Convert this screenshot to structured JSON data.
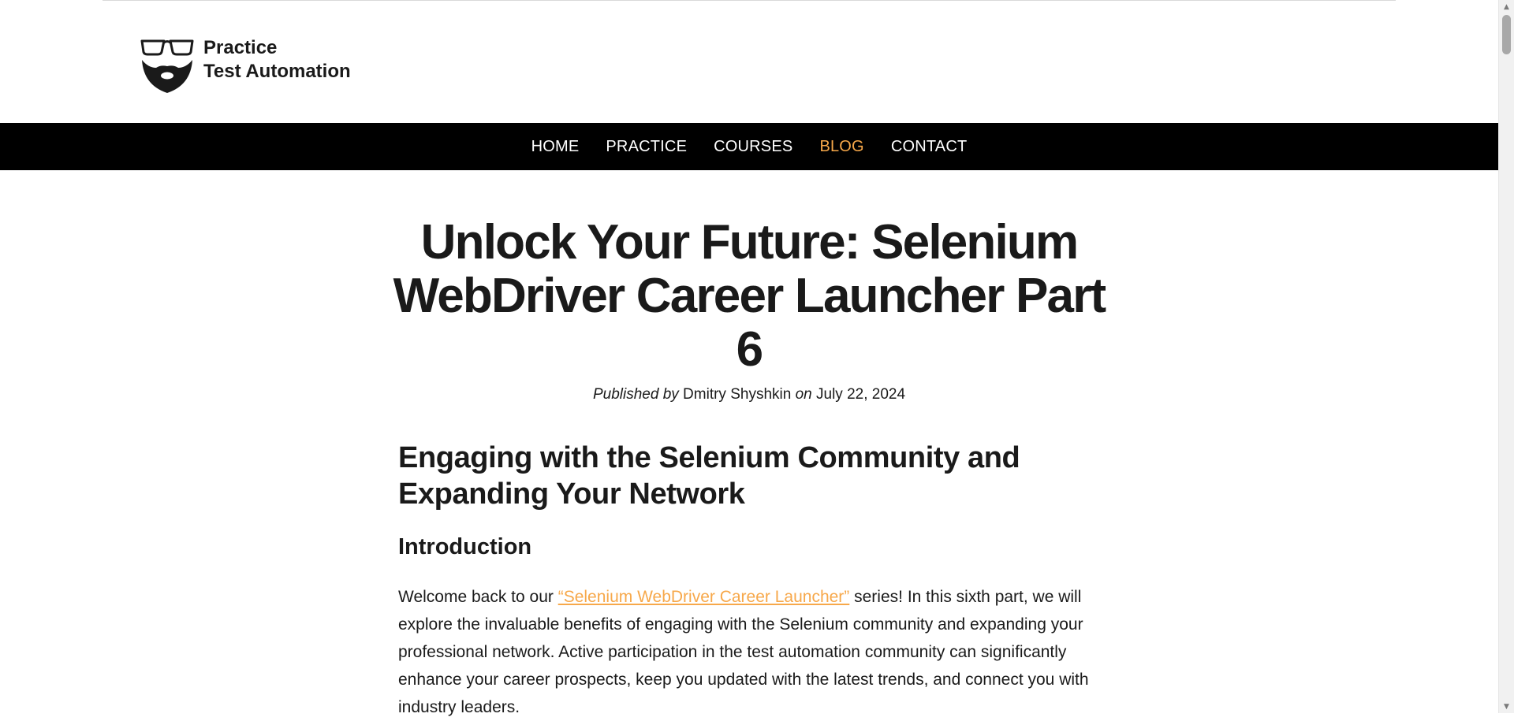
{
  "brand": {
    "line1": "Practice",
    "line2": "Test Automation"
  },
  "nav": {
    "items": [
      {
        "label": "HOME",
        "active": false
      },
      {
        "label": "PRACTICE",
        "active": false
      },
      {
        "label": "COURSES",
        "active": false
      },
      {
        "label": "BLOG",
        "active": true
      },
      {
        "label": "CONTACT",
        "active": false
      }
    ],
    "active_color": "#f7a84a"
  },
  "post": {
    "title": "Unlock Your Future: Selenium WebDriver Career Launcher Part 6",
    "meta": {
      "published_by_label": "Published by",
      "author": "Dmitry Shyshkin",
      "on_label": "on",
      "date": "July 22, 2024"
    },
    "section_heading": "Engaging with the Selenium Community and Expanding Your Network",
    "subheading": "Introduction",
    "intro": {
      "before_link": "Welcome back to our ",
      "link_text": "“Selenium WebDriver Career Launcher”",
      "after_link": " series! In this sixth part, we will explore the invaluable benefits of engaging with the Selenium community and expanding your professional network. Active participation in the test automation community can significantly enhance your career prospects, keep you updated with the latest trends, and connect you with industry leaders."
    }
  },
  "icons": {
    "logo": "glasses-beard-logo-icon",
    "scroll_up": "chevron-up-icon",
    "scroll_down": "chevron-down-icon"
  }
}
